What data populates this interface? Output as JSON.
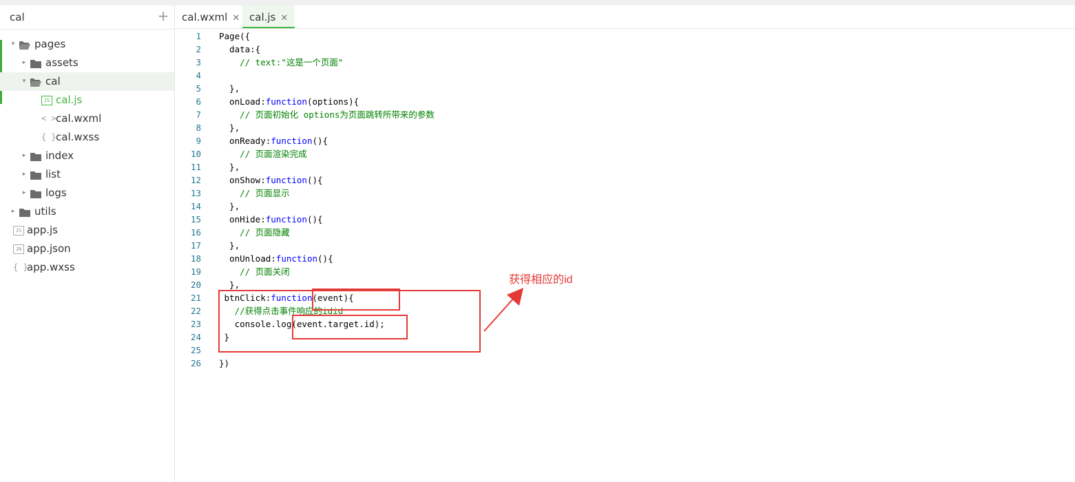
{
  "sidebar": {
    "project_name": "cal",
    "add_label": "+",
    "tree": [
      {
        "label": "pages",
        "type": "folder",
        "expanded": true,
        "level": 0
      },
      {
        "label": "assets",
        "type": "folder",
        "expanded": false,
        "level": 1
      },
      {
        "label": "cal",
        "type": "folder",
        "expanded": true,
        "level": 1,
        "selected": true
      },
      {
        "label": "cal.js",
        "type": "js",
        "icon": "JS",
        "level": 2,
        "active": true
      },
      {
        "label": "cal.wxml",
        "type": "wxml",
        "icon": "< >",
        "level": 2
      },
      {
        "label": "cal.wxss",
        "type": "wxss",
        "icon": "{ }",
        "level": 2
      },
      {
        "label": "index",
        "type": "folder",
        "expanded": false,
        "level": 1
      },
      {
        "label": "list",
        "type": "folder",
        "expanded": false,
        "level": 1
      },
      {
        "label": "logs",
        "type": "folder",
        "expanded": false,
        "level": 1
      },
      {
        "label": "utils",
        "type": "folder",
        "expanded": false,
        "level": 0
      },
      {
        "label": "app.js",
        "type": "js",
        "icon": "JS",
        "level": 0
      },
      {
        "label": "app.json",
        "type": "json",
        "icon": "JN",
        "level": 0
      },
      {
        "label": "app.wxss",
        "type": "wxss",
        "icon": "{ }",
        "level": 0
      }
    ]
  },
  "tabs": [
    {
      "label": "cal.wxml",
      "close": "✕",
      "active": false
    },
    {
      "label": "cal.js",
      "close": "✕",
      "active": true
    }
  ],
  "editor": {
    "lines": [
      [
        [
          "",
          "Page({"
        ]
      ],
      [
        [
          "",
          "  data:{"
        ]
      ],
      [
        [
          "cm",
          "    // text:"
        ],
        [
          "cm",
          "\"这是一个页面\""
        ]
      ],
      [
        [
          "",
          ""
        ]
      ],
      [
        [
          "",
          "  },"
        ]
      ],
      [
        [
          "",
          "  onLoad:"
        ],
        [
          "kw",
          "function"
        ],
        [
          "",
          "(options){"
        ]
      ],
      [
        [
          "cm",
          "    // 页面初始化 options为页面跳转所带来的参数"
        ]
      ],
      [
        [
          "",
          "  },"
        ]
      ],
      [
        [
          "",
          "  onReady:"
        ],
        [
          "kw",
          "function"
        ],
        [
          "",
          "(){"
        ]
      ],
      [
        [
          "cm",
          "    // 页面渲染完成"
        ]
      ],
      [
        [
          "",
          "  },"
        ]
      ],
      [
        [
          "",
          "  onShow:"
        ],
        [
          "kw",
          "function"
        ],
        [
          "",
          "(){"
        ]
      ],
      [
        [
          "cm",
          "    // 页面显示"
        ]
      ],
      [
        [
          "",
          "  },"
        ]
      ],
      [
        [
          "",
          "  onHide:"
        ],
        [
          "kw",
          "function"
        ],
        [
          "",
          "(){"
        ]
      ],
      [
        [
          "cm",
          "    // 页面隐藏"
        ]
      ],
      [
        [
          "",
          "  },"
        ]
      ],
      [
        [
          "",
          "  onUnload:"
        ],
        [
          "kw",
          "function"
        ],
        [
          "",
          "(){"
        ]
      ],
      [
        [
          "cm",
          "    // 页面关闭"
        ]
      ],
      [
        [
          "",
          "  },"
        ]
      ],
      [
        [
          "",
          " btnClick:"
        ],
        [
          "kw",
          "function"
        ],
        [
          "",
          "(event){"
        ]
      ],
      [
        [
          "cm",
          "   //获得点击事件响应的idid"
        ]
      ],
      [
        [
          "",
          "   console.log(event.target.id);"
        ]
      ],
      [
        [
          "",
          " }"
        ]
      ],
      [
        [
          "",
          ""
        ]
      ],
      [
        [
          "",
          "})"
        ]
      ]
    ]
  },
  "annotation": {
    "text": "获得相应的id",
    "color": "#e53935"
  },
  "colors": {
    "accent": "#41b641",
    "keyword": "#0000ff",
    "comment": "#008000",
    "line_number": "#237893"
  }
}
